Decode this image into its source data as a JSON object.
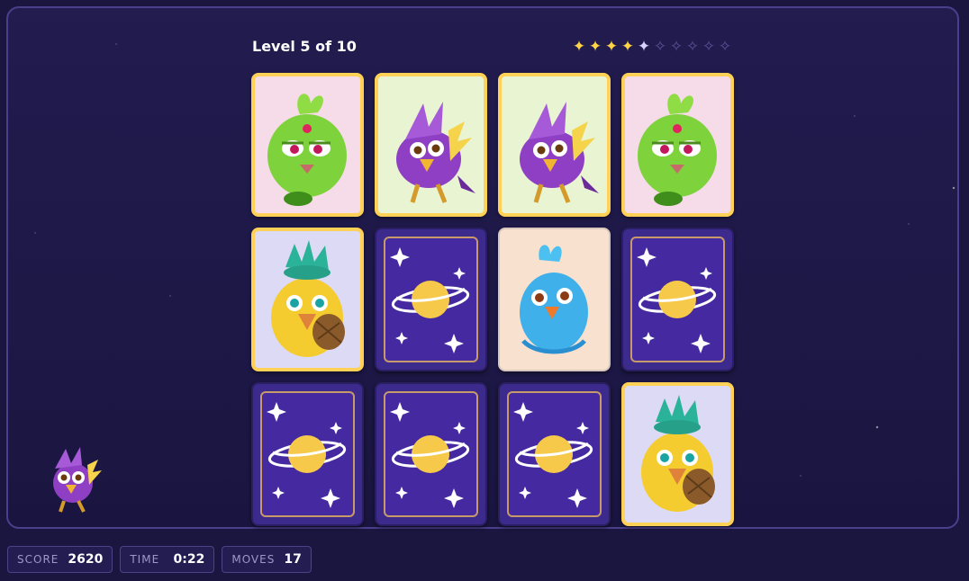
{
  "header": {
    "level_text": "Level 5 of 10",
    "stars": [
      "on",
      "on",
      "on",
      "on",
      "half",
      "off",
      "off",
      "off",
      "off",
      "off"
    ]
  },
  "cards": [
    {
      "state": "face",
      "creature": "green-sprout-chick",
      "bg": "pink"
    },
    {
      "state": "face",
      "creature": "purple-lightning-bird",
      "bg": "lime"
    },
    {
      "state": "face",
      "creature": "purple-lightning-bird",
      "bg": "lime"
    },
    {
      "state": "face",
      "creature": "green-sprout-chick",
      "bg": "pink"
    },
    {
      "state": "face",
      "creature": "yellow-pineapple-chick",
      "bg": "lav"
    },
    {
      "state": "back",
      "creature": "planet-card-back"
    },
    {
      "state": "face",
      "creature": "blue-water-bird",
      "bg": "peach"
    },
    {
      "state": "back",
      "creature": "planet-card-back"
    },
    {
      "state": "back",
      "creature": "planet-card-back"
    },
    {
      "state": "back",
      "creature": "planet-card-back"
    },
    {
      "state": "back",
      "creature": "planet-card-back"
    },
    {
      "state": "face",
      "creature": "yellow-pineapple-chick",
      "bg": "lav"
    }
  ],
  "hud": {
    "score_label": "SCORE",
    "score_value": "2620",
    "time_label": "TIME",
    "time_value": "0:22",
    "moves_label": "MOVES",
    "moves_value": "17"
  },
  "colors": {
    "star_on": "#ffd447",
    "card_border_matched": "#ffd257",
    "card_back": "#4429a0",
    "background": "#1b1640"
  }
}
